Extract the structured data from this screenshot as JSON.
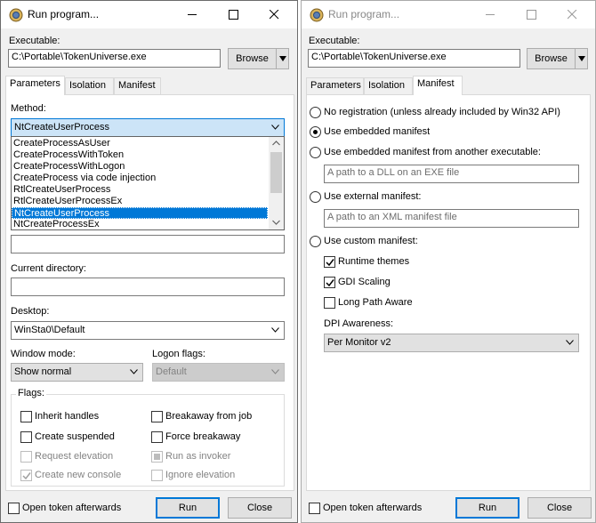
{
  "windows": [
    {
      "title": "Run program...",
      "executable_label": "Executable:",
      "executable_value": "C:\\Portable\\TokenUniverse.exe",
      "browse_label": "Browse",
      "tabs": [
        "Parameters",
        "Isolation",
        "Manifest"
      ],
      "active_tab": "Parameters",
      "method_label": "Method:",
      "method_value": "NtCreateUserProcess",
      "method_options": [
        "CreateProcessAsUser",
        "CreateProcessWithToken",
        "CreateProcessWithLogon",
        "CreateProcess via code injection",
        "RtlCreateUserProcess",
        "RtlCreateUserProcessEx",
        "NtCreateUserProcess",
        "NtCreateProcessEx"
      ],
      "current_directory_label": "Current directory:",
      "desktop_label": "Desktop:",
      "desktop_value": "WinSta0\\Default",
      "window_mode_label": "Window mode:",
      "window_mode_value": "Show normal",
      "logon_flags_label": "Logon flags:",
      "logon_flags_value": "Default",
      "flags_label": "Flags:",
      "flags": {
        "inherit_handles": "Inherit handles",
        "breakaway_from_job": "Breakaway from job",
        "create_suspended": "Create suspended",
        "force_breakaway": "Force breakaway",
        "request_elevation": "Request elevation",
        "run_as_invoker": "Run as invoker",
        "create_new_console": "Create new console",
        "ignore_elevation": "Ignore elevation"
      },
      "open_token_afterwards": "Open token afterwards",
      "run_label": "Run",
      "close_label": "Close"
    },
    {
      "title": "Run program...",
      "executable_label": "Executable:",
      "executable_value": "C:\\Portable\\TokenUniverse.exe",
      "browse_label": "Browse",
      "tabs": [
        "Parameters",
        "Isolation",
        "Manifest"
      ],
      "active_tab": "Manifest",
      "manifest": {
        "no_registration": "No registration (unless already included by Win32 API)",
        "use_embedded": "Use embedded manifest",
        "use_embedded_other": "Use embedded manifest from another executable:",
        "dll_placeholder": "A path to a DLL on an EXE file",
        "use_external": "Use external manifest:",
        "xml_placeholder": "A path to an XML manifest file",
        "use_custom": "Use custom manifest:",
        "runtime_themes": "Runtime themes",
        "gdi_scaling": "GDI Scaling",
        "long_path_aware": "Long Path Aware",
        "dpi_awareness_label": "DPI Awareness:",
        "dpi_awareness_value": "Per Monitor v2"
      },
      "open_token_afterwards": "Open token afterwards",
      "run_label": "Run",
      "close_label": "Close"
    }
  ],
  "icons": [
    "app-icon",
    "minimize-icon",
    "maximize-icon",
    "close-icon",
    "chevron-down-icon",
    "checkmark-icon"
  ]
}
